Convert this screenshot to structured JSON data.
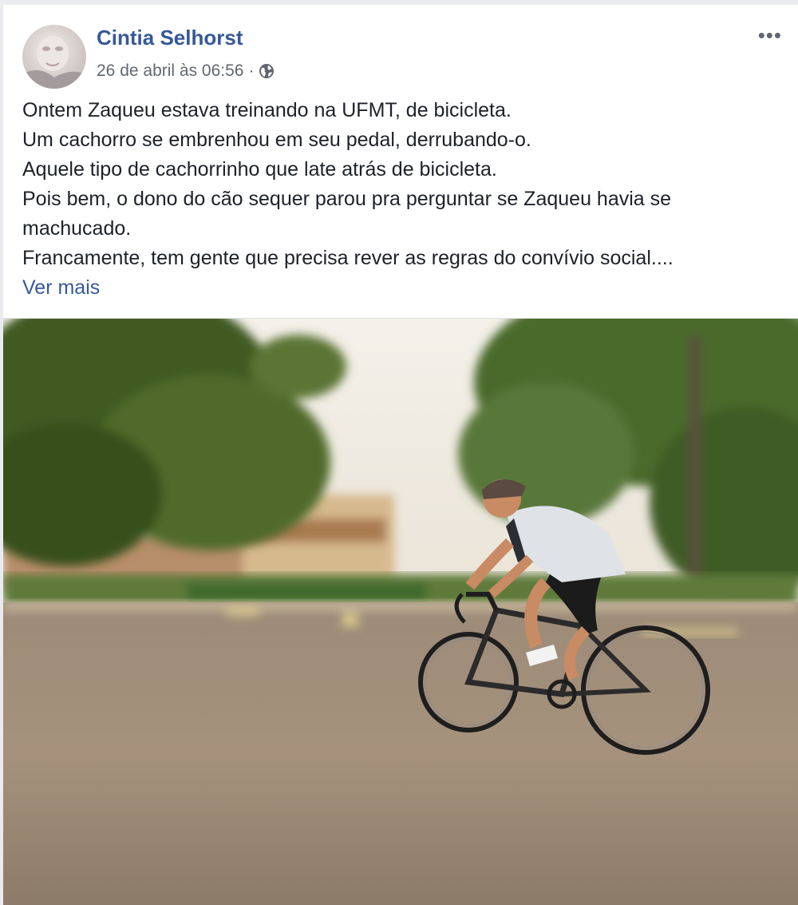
{
  "post": {
    "author": "Cintia Selhorst",
    "timestamp": "26 de abril às 06:56",
    "separator": "·",
    "privacy_icon": "globe-icon",
    "more_label": "•••",
    "lines": [
      "Ontem Zaqueu estava treinando na UFMT, de bicicleta.",
      "Um cachorro se embrenhou em seu pedal, derrubando-o.",
      "Aquele tipo de cachorrinho que late atrás de bicicleta.",
      "Pois bem, o dono do cão sequer parou pra perguntar se Zaqueu havia se machucado.",
      "Francamente, tem gente que precisa rever as regras do convívio social...."
    ],
    "see_more": "Ver mais"
  },
  "colors": {
    "link": "#365899",
    "meta": "#616770",
    "text": "#1d2129",
    "background": "#e9ebee"
  }
}
